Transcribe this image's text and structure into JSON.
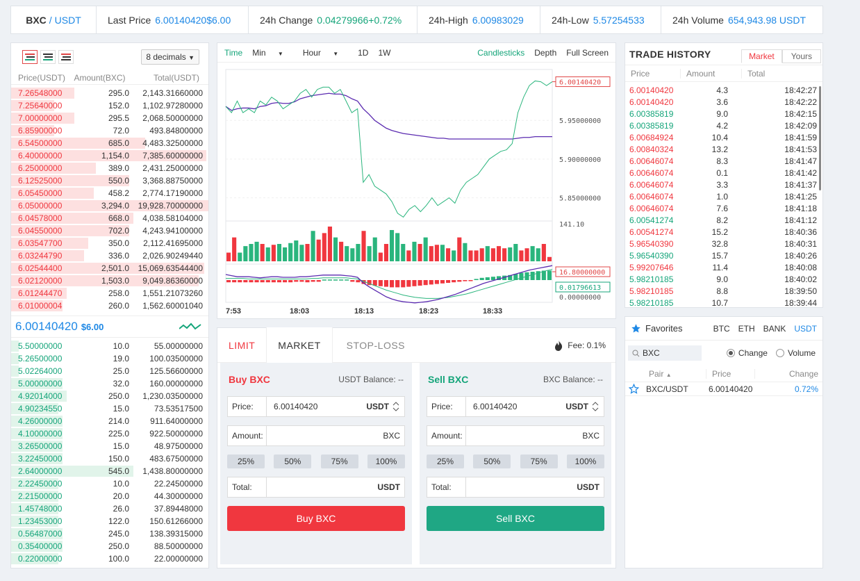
{
  "ticker": {
    "base": "BXC",
    "sep": "/",
    "quote": "USDT",
    "last_label": "Last Price",
    "last_value": "6.00140420",
    "last_fiat": "$6.00",
    "change_label": "24h Change",
    "change_value": "0.04279966",
    "change_pct": "+0.72%",
    "high_label": "24h-High",
    "high_value": "6.00983029",
    "low_label": "24h-Low",
    "low_value": "5.57254533",
    "vol_label": "24h Volume",
    "vol_value": "654,943.98 USDT"
  },
  "orderbook": {
    "decimals": "8 decimals",
    "headers": [
      "Price(USDT)",
      "Amount(BXC)",
      "Total(USDT)"
    ],
    "asks": [
      {
        "price": "7.26548000",
        "amount": "295.0",
        "total": "2,143.31660000",
        "depth": 0.32
      },
      {
        "price": "7.25640000",
        "amount": "152.0",
        "total": "1,102.97280000",
        "depth": 0.22
      },
      {
        "price": "7.00000000",
        "amount": "295.5",
        "total": "2,068.50000000",
        "depth": 0.32
      },
      {
        "price": "6.85900000",
        "amount": "72.0",
        "total": "493.84800000",
        "depth": 0.22
      },
      {
        "price": "6.54500000",
        "amount": "685.0",
        "total": "4,483.32500000",
        "depth": 0.68
      },
      {
        "price": "6.40000000",
        "amount": "1,154.0",
        "total": "7,385.60000000",
        "depth": 0.99
      },
      {
        "price": "6.25000000",
        "amount": "389.0",
        "total": "2,431.25000000",
        "depth": 0.43
      },
      {
        "price": "6.12525000",
        "amount": "550.0",
        "total": "3,368.88750000",
        "depth": 0.6
      },
      {
        "price": "6.05450000",
        "amount": "458.2",
        "total": "2,774.17190000",
        "depth": 0.42
      },
      {
        "price": "6.05000000",
        "amount": "3,294.0",
        "total": "19,928.70000000",
        "depth": 1.0
      },
      {
        "price": "6.04578000",
        "amount": "668.0",
        "total": "4,038.58104000",
        "depth": 0.62
      },
      {
        "price": "6.04550000",
        "amount": "702.0",
        "total": "4,243.94100000",
        "depth": 0.6
      },
      {
        "price": "6.03547700",
        "amount": "350.0",
        "total": "2,112.41695000",
        "depth": 0.39
      },
      {
        "price": "6.03244790",
        "amount": "336.0",
        "total": "2,026.90249440",
        "depth": 0.37
      },
      {
        "price": "6.02544400",
        "amount": "2,501.0",
        "total": "15,069.63544400",
        "depth": 0.98
      },
      {
        "price": "6.02120000",
        "amount": "1,503.0",
        "total": "9,049.86360000",
        "depth": 0.95
      },
      {
        "price": "6.01244470",
        "amount": "258.0",
        "total": "1,551.21073260",
        "depth": 0.28
      },
      {
        "price": "6.01000004",
        "amount": "260.0",
        "total": "1,562.60001040",
        "depth": 0.26
      }
    ],
    "mid_price": "6.00140420",
    "mid_fiat": "$6.00",
    "bids": [
      {
        "price": "5.50000000",
        "amount": "10.0",
        "total": "55.00000000",
        "depth": 0.04
      },
      {
        "price": "5.26500000",
        "amount": "19.0",
        "total": "100.03500000",
        "depth": 0.04
      },
      {
        "price": "5.02264000",
        "amount": "25.0",
        "total": "125.56600000",
        "depth": 0.04
      },
      {
        "price": "5.00000000",
        "amount": "32.0",
        "total": "160.00000000",
        "depth": 0.26
      },
      {
        "price": "4.92014000",
        "amount": "250.0",
        "total": "1,230.03500000",
        "depth": 0.28
      },
      {
        "price": "4.90234550",
        "amount": "15.0",
        "total": "73.53517500",
        "depth": 0.24
      },
      {
        "price": "4.26000000",
        "amount": "214.0",
        "total": "911.64000000",
        "depth": 0.26
      },
      {
        "price": "4.10000000",
        "amount": "225.0",
        "total": "922.50000000",
        "depth": 0.26
      },
      {
        "price": "3.26500000",
        "amount": "15.0",
        "total": "48.97500000",
        "depth": 0.26
      },
      {
        "price": "3.22450000",
        "amount": "150.0",
        "total": "483.67500000",
        "depth": 0.26
      },
      {
        "price": "2.64000000",
        "amount": "545.0",
        "total": "1,438.80000000",
        "depth": 0.62
      },
      {
        "price": "2.22450000",
        "amount": "10.0",
        "total": "22.24500000",
        "depth": 0.24
      },
      {
        "price": "2.21500000",
        "amount": "20.0",
        "total": "44.30000000",
        "depth": 0.24
      },
      {
        "price": "1.45748000",
        "amount": "26.0",
        "total": "37.89448000",
        "depth": 0.24
      },
      {
        "price": "1.23453000",
        "amount": "122.0",
        "total": "150.61266000",
        "depth": 0.24
      },
      {
        "price": "0.56487000",
        "amount": "245.0",
        "total": "138.39315000",
        "depth": 0.26
      },
      {
        "price": "0.35400000",
        "amount": "250.0",
        "total": "88.50000000",
        "depth": 0.26
      },
      {
        "price": "0.22000000",
        "amount": "100.0",
        "total": "22.00000000",
        "depth": 0.24
      }
    ]
  },
  "chart": {
    "toolbar": {
      "time": "Time",
      "min": "Min",
      "hour": "Hour",
      "d1": "1D",
      "w1": "1W",
      "candles": "Candlesticks",
      "depth": "Depth",
      "fullscreen": "Full Screen"
    },
    "price_ticks": [
      "5.95000000",
      "5.90000000",
      "5.85000000"
    ],
    "price_tag": "6.00140420",
    "vol_max": "141.10",
    "vol_tag": "16.80000000",
    "macd_tag": "0.01796613",
    "macd_zero": "0.00000000",
    "x_ticks": [
      "7:53",
      "18:03",
      "18:13",
      "18:23",
      "18:33"
    ],
    "price_series": [
      5.968,
      5.96,
      5.975,
      5.96,
      5.965,
      5.96,
      5.975,
      5.97,
      5.98,
      5.975,
      5.965,
      5.97,
      5.975,
      5.985,
      5.99,
      5.98,
      5.99,
      5.993,
      5.993,
      5.985,
      5.99,
      5.975,
      5.96,
      5.965,
      5.87,
      5.88,
      5.865,
      5.86,
      5.855,
      5.845,
      5.83,
      5.825,
      5.835,
      5.84,
      5.832,
      5.84,
      5.85,
      5.84,
      5.845,
      5.85,
      5.843,
      5.86,
      5.87,
      5.875,
      5.88,
      5.89,
      5.9,
      5.905,
      5.91,
      5.912,
      5.92,
      5.96,
      5.98,
      5.995,
      6.001,
      6.0,
      5.995,
      6.0
    ],
    "ma_series": [
      5.968,
      5.963,
      5.965,
      5.966,
      5.966,
      5.965,
      5.968,
      5.969,
      5.972,
      5.973,
      5.972,
      5.972,
      5.974,
      5.978,
      5.98,
      5.982,
      5.983,
      5.984,
      5.985,
      5.984,
      5.984,
      5.982,
      5.978,
      5.975,
      5.965,
      5.958,
      5.95,
      5.945,
      5.94,
      5.937,
      5.935,
      5.933,
      5.932,
      5.931,
      5.93,
      5.929,
      5.928,
      5.927,
      5.927,
      5.926,
      5.926,
      5.926,
      5.926,
      5.926,
      5.926,
      5.926,
      5.926,
      5.926,
      5.926,
      5.926,
      5.926,
      5.927,
      5.928,
      5.928,
      5.929,
      5.929,
      5.929,
      5.929
    ],
    "volumes": [
      [
        20,
        1
      ],
      [
        55,
        1
      ],
      [
        20,
        0
      ],
      [
        35,
        0
      ],
      [
        40,
        0
      ],
      [
        45,
        0
      ],
      [
        40,
        1
      ],
      [
        32,
        0
      ],
      [
        38,
        1
      ],
      [
        40,
        0
      ],
      [
        32,
        0
      ],
      [
        42,
        0
      ],
      [
        48,
        0
      ],
      [
        38,
        0
      ],
      [
        40,
        1
      ],
      [
        70,
        0
      ],
      [
        50,
        1
      ],
      [
        65,
        1
      ],
      [
        80,
        1
      ],
      [
        55,
        0
      ],
      [
        45,
        1
      ],
      [
        35,
        0
      ],
      [
        30,
        0
      ],
      [
        40,
        0
      ],
      [
        70,
        1
      ],
      [
        35,
        0
      ],
      [
        55,
        0
      ],
      [
        20,
        1
      ],
      [
        40,
        1
      ],
      [
        72,
        0
      ],
      [
        65,
        0
      ],
      [
        40,
        0
      ],
      [
        25,
        1
      ],
      [
        45,
        0
      ],
      [
        40,
        1
      ],
      [
        55,
        0
      ],
      [
        35,
        1
      ],
      [
        38,
        1
      ],
      [
        38,
        0
      ],
      [
        30,
        1
      ],
      [
        25,
        0
      ],
      [
        55,
        1
      ],
      [
        42,
        0
      ],
      [
        25,
        1
      ],
      [
        25,
        1
      ],
      [
        30,
        1
      ],
      [
        35,
        0
      ],
      [
        30,
        1
      ],
      [
        35,
        1
      ],
      [
        30,
        1
      ],
      [
        32,
        0
      ],
      [
        40,
        0
      ],
      [
        25,
        1
      ],
      [
        30,
        1
      ],
      [
        35,
        0
      ],
      [
        30,
        0
      ],
      [
        40,
        1
      ],
      [
        10,
        1
      ]
    ],
    "macd_hist": [
      -0.004,
      -0.004,
      -0.004,
      -0.004,
      -0.004,
      -0.004,
      -0.004,
      -0.004,
      -0.004,
      -0.004,
      -0.004,
      -0.004,
      -0.003,
      -0.003,
      -0.004,
      -0.003,
      -0.003,
      0.001,
      0.001,
      0.001,
      0.001,
      0.001,
      -0.003,
      -0.004,
      -0.007,
      -0.009,
      -0.01,
      -0.011,
      -0.012,
      -0.013,
      -0.013,
      -0.013,
      -0.012,
      -0.011,
      -0.01,
      -0.009,
      -0.008,
      -0.007,
      -0.006,
      -0.005,
      -0.004,
      -0.003,
      -0.002,
      -0.001,
      0.002,
      0.004,
      0.005,
      0.006,
      0.007,
      0.008,
      0.009,
      0.011,
      0.013,
      0.014,
      0.015,
      0.016,
      0.017,
      0.017
    ],
    "macd_line": [
      0.01,
      0.008,
      0.006,
      0.006,
      0.006,
      0.005,
      0.004,
      0.005,
      0.006,
      0.006,
      0.005,
      0.005,
      0.005,
      0.006,
      0.006,
      0.007,
      0.008,
      0.009,
      0.009,
      0.009,
      0.009,
      0.008,
      0.007,
      0.005,
      -0.005,
      -0.012,
      -0.018,
      -0.024,
      -0.03,
      -0.034,
      -0.037,
      -0.039,
      -0.04,
      -0.041,
      -0.04,
      -0.039,
      -0.037,
      -0.035,
      -0.032,
      -0.029,
      -0.026,
      -0.022,
      -0.018,
      -0.014,
      -0.01,
      -0.006,
      -0.003,
      0.0,
      0.003,
      0.006,
      0.009,
      0.012,
      0.015,
      0.018,
      0.02,
      0.022,
      0.024,
      0.026
    ],
    "signal_line": [
      0.003,
      0.003,
      0.003,
      0.003,
      0.002,
      0.002,
      0.002,
      0.002,
      0.002,
      0.002,
      0.002,
      0.002,
      0.002,
      0.002,
      0.002,
      0.003,
      0.003,
      0.004,
      0.004,
      0.004,
      0.004,
      0.004,
      0.003,
      0.002,
      -0.002,
      -0.006,
      -0.01,
      -0.014,
      -0.018,
      -0.021,
      -0.024,
      -0.027,
      -0.029,
      -0.031,
      -0.032,
      -0.033,
      -0.033,
      -0.033,
      -0.032,
      -0.031,
      -0.029,
      -0.027,
      -0.025,
      -0.022,
      -0.019,
      -0.016,
      -0.013,
      -0.01,
      -0.007,
      -0.004,
      -0.001,
      0.002,
      0.005,
      0.008,
      0.011,
      0.014,
      0.017,
      0.019
    ]
  },
  "form": {
    "tabs": [
      "LIMIT",
      "MARKET",
      "STOP-LOSS"
    ],
    "fee_label": "Fee: 0.1%",
    "buy": {
      "title": "Buy BXC",
      "balance": "USDT Balance: --",
      "price_label": "Price:",
      "price_value": "6.00140420",
      "price_unit": "USDT",
      "amount_label": "Amount:",
      "amount_unit": "BXC",
      "total_label": "Total:",
      "total_unit": "USDT",
      "button": "Buy BXC"
    },
    "sell": {
      "title": "Sell BXC",
      "balance": "BXC Balance: --",
      "price_label": "Price:",
      "price_value": "6.00140420",
      "price_unit": "USDT",
      "amount_label": "Amount:",
      "amount_unit": "BXC",
      "total_label": "Total:",
      "total_unit": "USDT",
      "button": "Sell BXC"
    },
    "pcts": [
      "25%",
      "50%",
      "75%",
      "100%"
    ]
  },
  "history": {
    "title": "TRADE HISTORY",
    "tab_market": "Market",
    "tab_yours": "Yours",
    "headers": [
      "Price",
      "Amount",
      "Total"
    ],
    "rows": [
      {
        "price": "6.00140420",
        "amount": "4.3",
        "time": "18:42:27",
        "side": "sell"
      },
      {
        "price": "6.00140420",
        "amount": "3.6",
        "time": "18:42:22",
        "side": "sell"
      },
      {
        "price": "6.00385819",
        "amount": "9.0",
        "time": "18:42:15",
        "side": "buy"
      },
      {
        "price": "6.00385819",
        "amount": "4.2",
        "time": "18:42:09",
        "side": "buy"
      },
      {
        "price": "6.00684924",
        "amount": "10.4",
        "time": "18:41:59",
        "side": "sell"
      },
      {
        "price": "6.00840324",
        "amount": "13.2",
        "time": "18:41:53",
        "side": "sell"
      },
      {
        "price": "6.00646074",
        "amount": "8.3",
        "time": "18:41:47",
        "side": "sell"
      },
      {
        "price": "6.00646074",
        "amount": "0.1",
        "time": "18:41:42",
        "side": "sell"
      },
      {
        "price": "6.00646074",
        "amount": "3.3",
        "time": "18:41:37",
        "side": "sell"
      },
      {
        "price": "6.00646074",
        "amount": "1.0",
        "time": "18:41:25",
        "side": "sell"
      },
      {
        "price": "6.00646074",
        "amount": "7.6",
        "time": "18:41:18",
        "side": "sell"
      },
      {
        "price": "6.00541274",
        "amount": "8.2",
        "time": "18:41:12",
        "side": "buy"
      },
      {
        "price": "6.00541274",
        "amount": "15.2",
        "time": "18:40:36",
        "side": "sell"
      },
      {
        "price": "5.96540390",
        "amount": "32.8",
        "time": "18:40:31",
        "side": "sell"
      },
      {
        "price": "5.96540390",
        "amount": "15.7",
        "time": "18:40:26",
        "side": "buy"
      },
      {
        "price": "5.99207646",
        "amount": "11.4",
        "time": "18:40:08",
        "side": "sell"
      },
      {
        "price": "5.98210185",
        "amount": "9.0",
        "time": "18:40:02",
        "side": "buy"
      },
      {
        "price": "5.98210185",
        "amount": "8.8",
        "time": "18:39:50",
        "side": "sell"
      },
      {
        "price": "5.98210185",
        "amount": "10.7",
        "time": "18:39:44",
        "side": "buy"
      }
    ]
  },
  "favorites": {
    "title": "Favorites",
    "markets": [
      "BTC",
      "ETH",
      "BANK",
      "USDT"
    ],
    "search_value": "BXC",
    "radio_change": "Change",
    "radio_volume": "Volume",
    "headers": [
      "Pair",
      "Price",
      "Change"
    ],
    "rows": [
      {
        "pair": "BXC/USDT",
        "price": "6.00140420",
        "change": "0.72%"
      }
    ]
  },
  "colors": {
    "red": "#f0373f",
    "green": "#15a57a",
    "blue": "#1e88e5",
    "ask_bar": "#fde0e0",
    "bid_bar": "#e1f4ea",
    "purple": "#5b2bb0"
  }
}
